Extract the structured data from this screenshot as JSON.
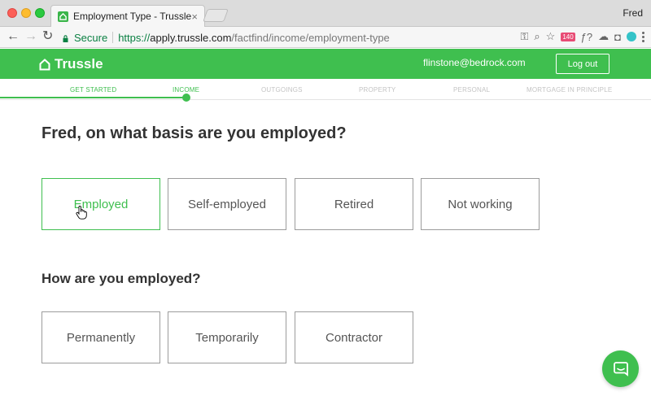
{
  "browser": {
    "tab_title": "Employment Type - Trussle - T",
    "tab_close": "×",
    "profile_name": "Fred",
    "secure_label": "Secure",
    "url_proto": "https://",
    "url_host": "apply.trussle.com",
    "url_path": "/factfind/income/employment-type",
    "ext_badge": "140",
    "font_icon": "ƒ?"
  },
  "header": {
    "brand": "Trussle",
    "email": "flinstone@bedrock.com",
    "logout_label": "Log out"
  },
  "progress": {
    "steps": [
      {
        "label": "GET STARTED",
        "state": "done"
      },
      {
        "label": "INCOME",
        "state": "active"
      },
      {
        "label": "OUTGOINGS",
        "state": "pending"
      },
      {
        "label": "PROPERTY",
        "state": "pending"
      },
      {
        "label": "PERSONAL",
        "state": "pending"
      },
      {
        "label": "MORTGAGE IN PRINCIPLE",
        "state": "pending"
      }
    ]
  },
  "main": {
    "question1": "Fred, on what basis are you employed?",
    "basis_options": [
      {
        "label": "Employed",
        "selected": true
      },
      {
        "label": "Self-employed",
        "selected": false
      },
      {
        "label": "Retired",
        "selected": false
      },
      {
        "label": "Not working",
        "selected": false
      }
    ],
    "question2": "How are you employed?",
    "type_options": [
      {
        "label": "Permanently",
        "selected": false
      },
      {
        "label": "Temporarily",
        "selected": false
      },
      {
        "label": "Contractor",
        "selected": false
      }
    ]
  },
  "colors": {
    "brand_green": "#3fbf4f",
    "border_gray": "#9c9c9c",
    "text_dark": "#333333"
  },
  "icons": {
    "home": "home-icon",
    "lock": "lock-icon",
    "chat": "chat-icon",
    "cursor": "hand-pointer-icon"
  }
}
